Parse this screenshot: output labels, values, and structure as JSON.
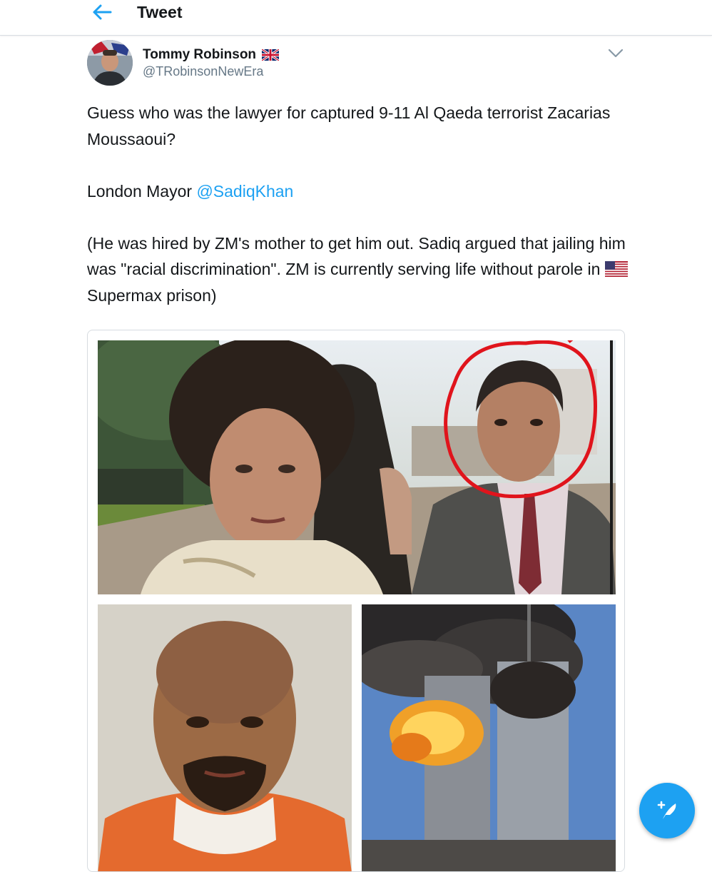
{
  "header": {
    "title": "Tweet",
    "back_icon": "arrow-left-icon"
  },
  "tweet": {
    "author": {
      "name": "Tommy Robinson",
      "handle": "@TRobinsonNewEra",
      "badge_icon": "uk-flag-icon"
    },
    "menu_icon": "chevron-down-icon",
    "text": {
      "p1": "Guess who was the lawyer for captured 9-11 Al Qaeda terrorist Zacarias Moussaoui?",
      "p2_prefix": "London Mayor ",
      "p2_mention": "@SadiqKhan",
      "p3_prefix": "(He was hired by ZM's mother to get him out. Sadiq argued that jailing him was \"racial discrimination\". ZM is currently serving life without parole in ",
      "p3_flag_icon": "us-flag-icon",
      "p3_suffix": "Supermax prison)"
    },
    "media": {
      "photos": [
        "news-photo",
        "mugshot-photo",
        "towers-photo"
      ]
    }
  },
  "compose": {
    "icon": "compose-feather-icon"
  },
  "colors": {
    "accent": "#1da1f2",
    "text": "#14171a",
    "secondary": "#657786",
    "circle": "#e0141c"
  }
}
